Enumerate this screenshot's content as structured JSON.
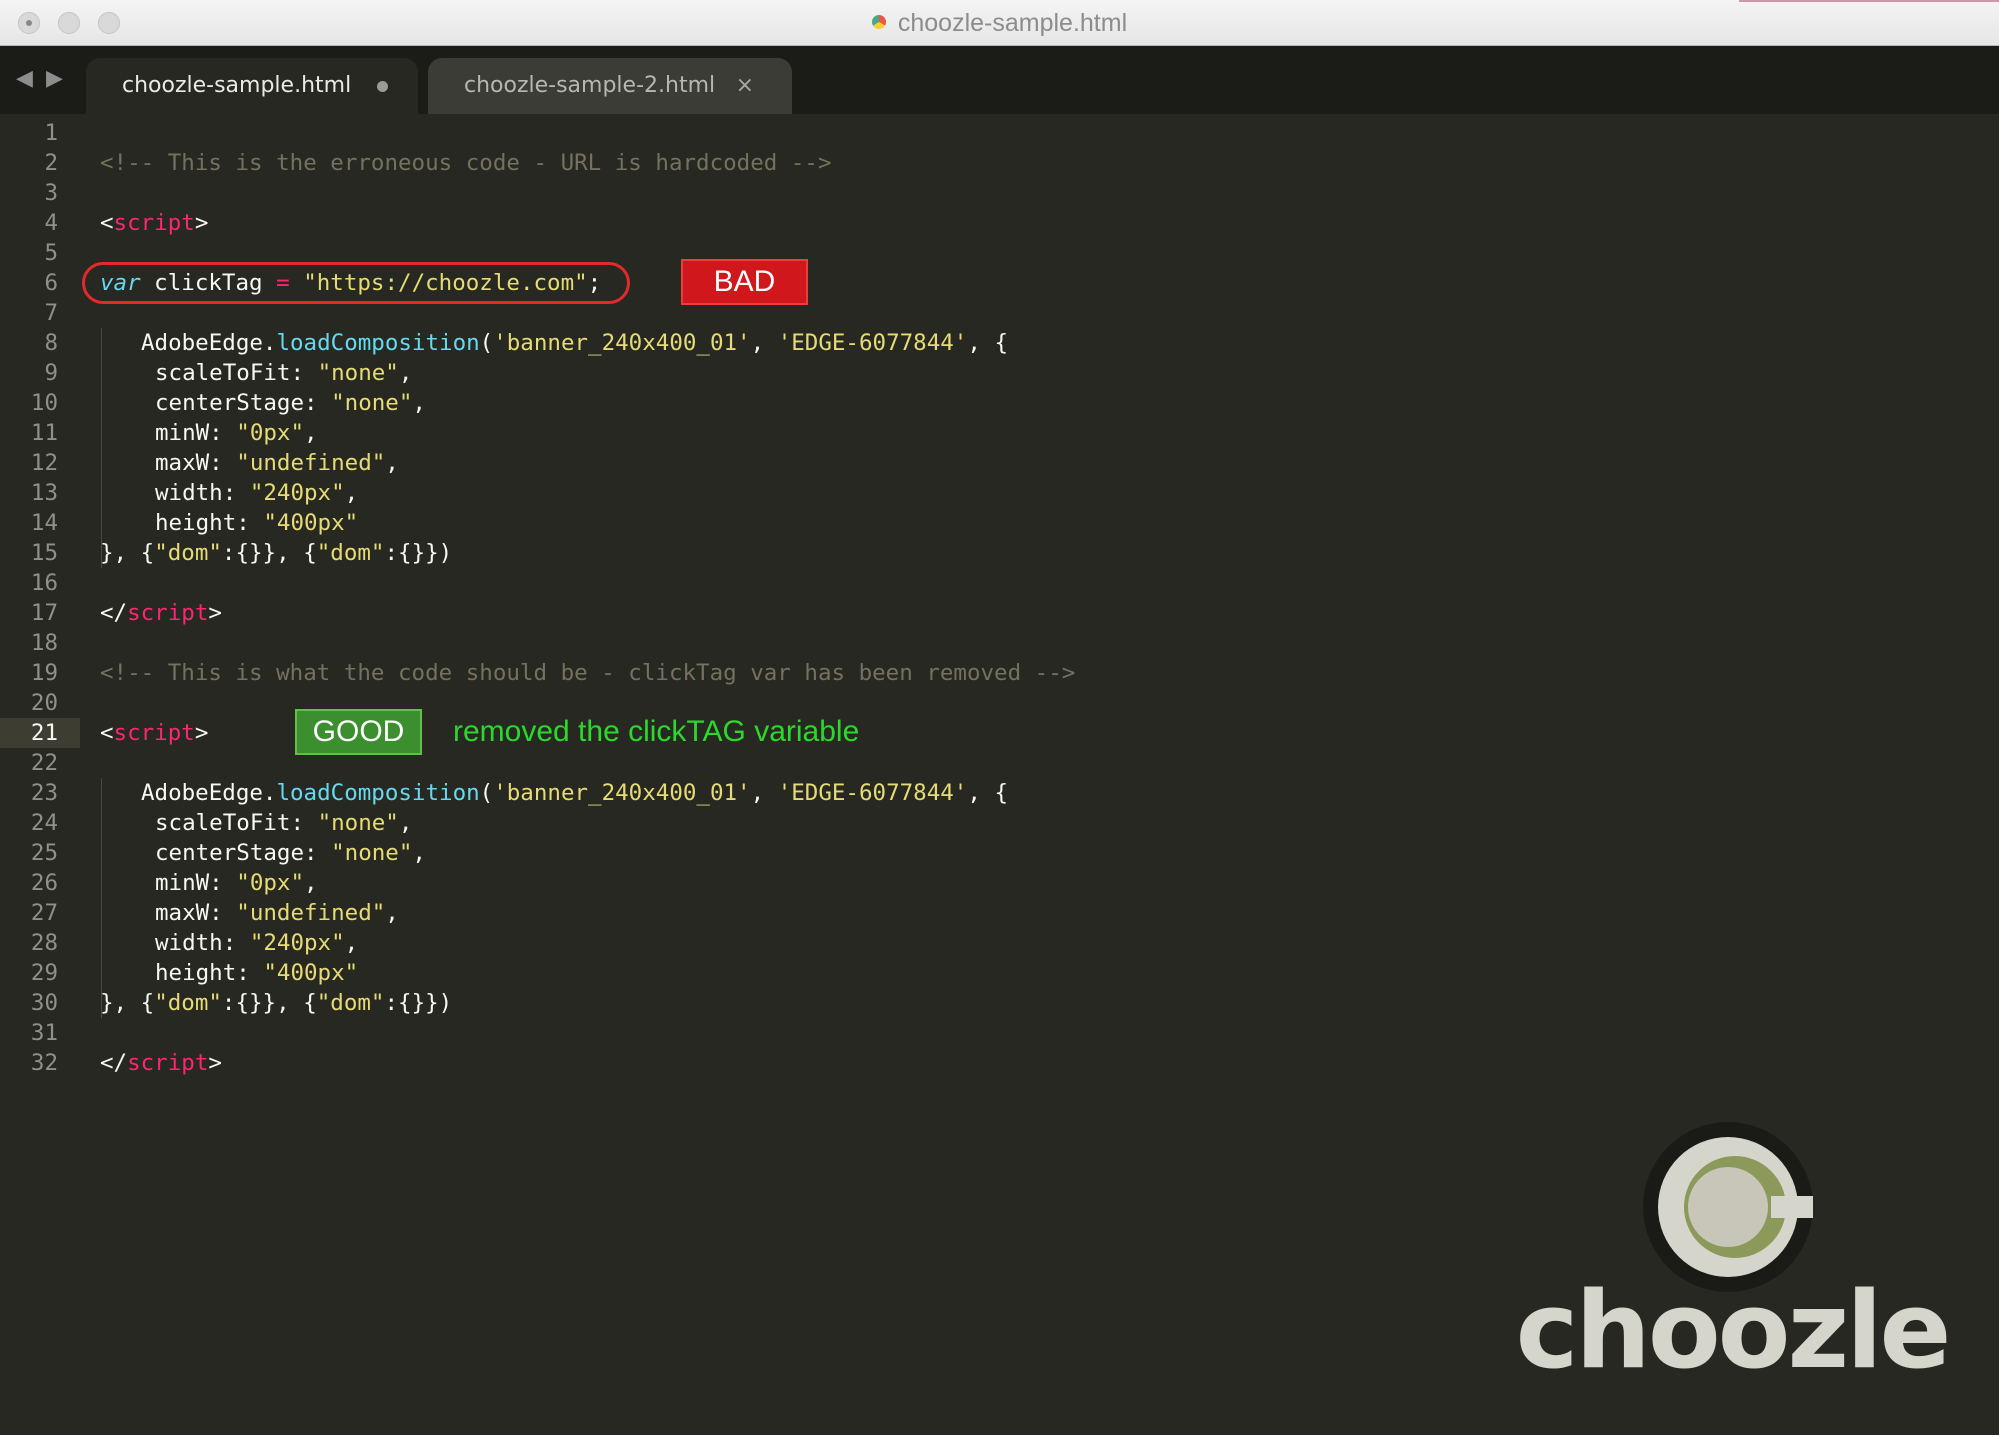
{
  "window": {
    "title": "choozle-sample.html"
  },
  "tabs": [
    {
      "label": "choozle-sample.html",
      "state": "modified"
    },
    {
      "label": "choozle-sample-2.html",
      "state": "close"
    }
  ],
  "editor": {
    "current_line": 21,
    "lines": [
      {
        "n": "1"
      },
      {
        "n": "2"
      },
      {
        "n": "3"
      },
      {
        "n": "4"
      },
      {
        "n": "5"
      },
      {
        "n": "6"
      },
      {
        "n": "7"
      },
      {
        "n": "8"
      },
      {
        "n": "9"
      },
      {
        "n": "10"
      },
      {
        "n": "11"
      },
      {
        "n": "12"
      },
      {
        "n": "13"
      },
      {
        "n": "14"
      },
      {
        "n": "15"
      },
      {
        "n": "16"
      },
      {
        "n": "17"
      },
      {
        "n": "18"
      },
      {
        "n": "19"
      },
      {
        "n": "20"
      },
      {
        "n": "21"
      },
      {
        "n": "22"
      },
      {
        "n": "23"
      },
      {
        "n": "24"
      },
      {
        "n": "25"
      },
      {
        "n": "26"
      },
      {
        "n": "27"
      },
      {
        "n": "28"
      },
      {
        "n": "29"
      },
      {
        "n": "30"
      },
      {
        "n": "31"
      },
      {
        "n": "32"
      }
    ],
    "code": {
      "comment_bad": "<!-- This is the erroneous code - URL is hardcoded -->",
      "comment_good": "<!-- This is what the code should be - clickTag var has been removed -->",
      "lt": "<",
      "gt": ">",
      "lt_slash": "</",
      "script_tag": "script",
      "var_kw": "var",
      "clicktag_name": " clickTag ",
      "eq": "=",
      "clicktag_value": " \"https://choozle.com\"",
      "semicolon": ";",
      "adobe_obj": "AdobeEdge.",
      "load_fn": "loadComposition",
      "paren_open": "(",
      "arg1": "'banner_240x400_01'",
      "comma_sp": ", ",
      "arg2": "'EDGE-6077844'",
      "brace_open": ", {",
      "opt_scale_key": "scaleToFit: ",
      "opt_scale_val": "\"none\"",
      "comma": ",",
      "opt_center_key": "centerStage: ",
      "opt_center_val": "\"none\"",
      "opt_minw_key": "minW: ",
      "opt_minw_val": "\"0px\"",
      "opt_maxw_key": "maxW: ",
      "opt_maxw_val": "\"undefined\"",
      "opt_width_key": "width: ",
      "opt_width_val": "\"240px\"",
      "opt_height_key": "height: ",
      "opt_height_val": "\"400px\"",
      "close_a": "}, {",
      "dom_key": "\"dom\"",
      "close_b": ":{}}, {",
      "close_c": ":{}})"
    }
  },
  "annotations": {
    "bad_label": "BAD",
    "good_label": "GOOD",
    "good_note": "removed the clickTAG variable"
  },
  "logo": {
    "wordmark": "choozle"
  },
  "colors": {
    "background": "#272822",
    "comment": "#75715e",
    "tag": "#f92672",
    "string": "#e6db74",
    "function": "#66d9ef",
    "bad": "#d0171b",
    "good": "#3c8f2e",
    "good_text": "#2bd82b",
    "logo_olive": "#8b9a5b"
  },
  "icons": {
    "tab_back": "triangle-left",
    "tab_forward": "triangle-right",
    "tab_modified": "dot",
    "tab_close": "x"
  }
}
